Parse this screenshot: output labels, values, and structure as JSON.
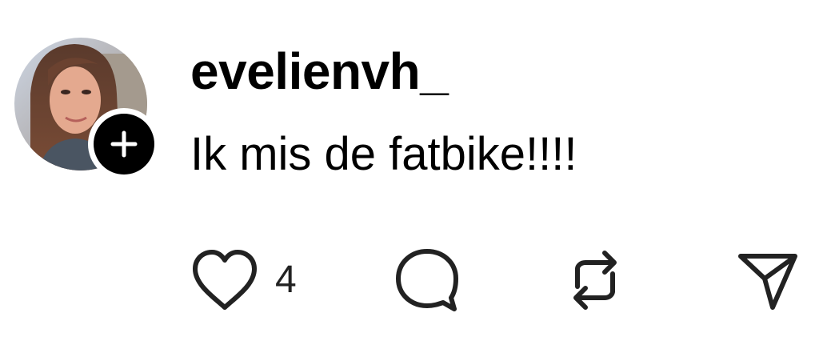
{
  "comment": {
    "username": "evelienvh_",
    "text": "Ik mis de fatbike!!!!",
    "like_count": "4"
  },
  "icons": {
    "follow": "plus-icon",
    "like": "heart-icon",
    "reply": "speech-bubble-icon",
    "repost": "repost-arrows-icon",
    "share": "paper-plane-icon"
  },
  "colors": {
    "text": "#000000",
    "badge": "#000000",
    "icon_stroke": "#222222",
    "background": "#ffffff"
  }
}
